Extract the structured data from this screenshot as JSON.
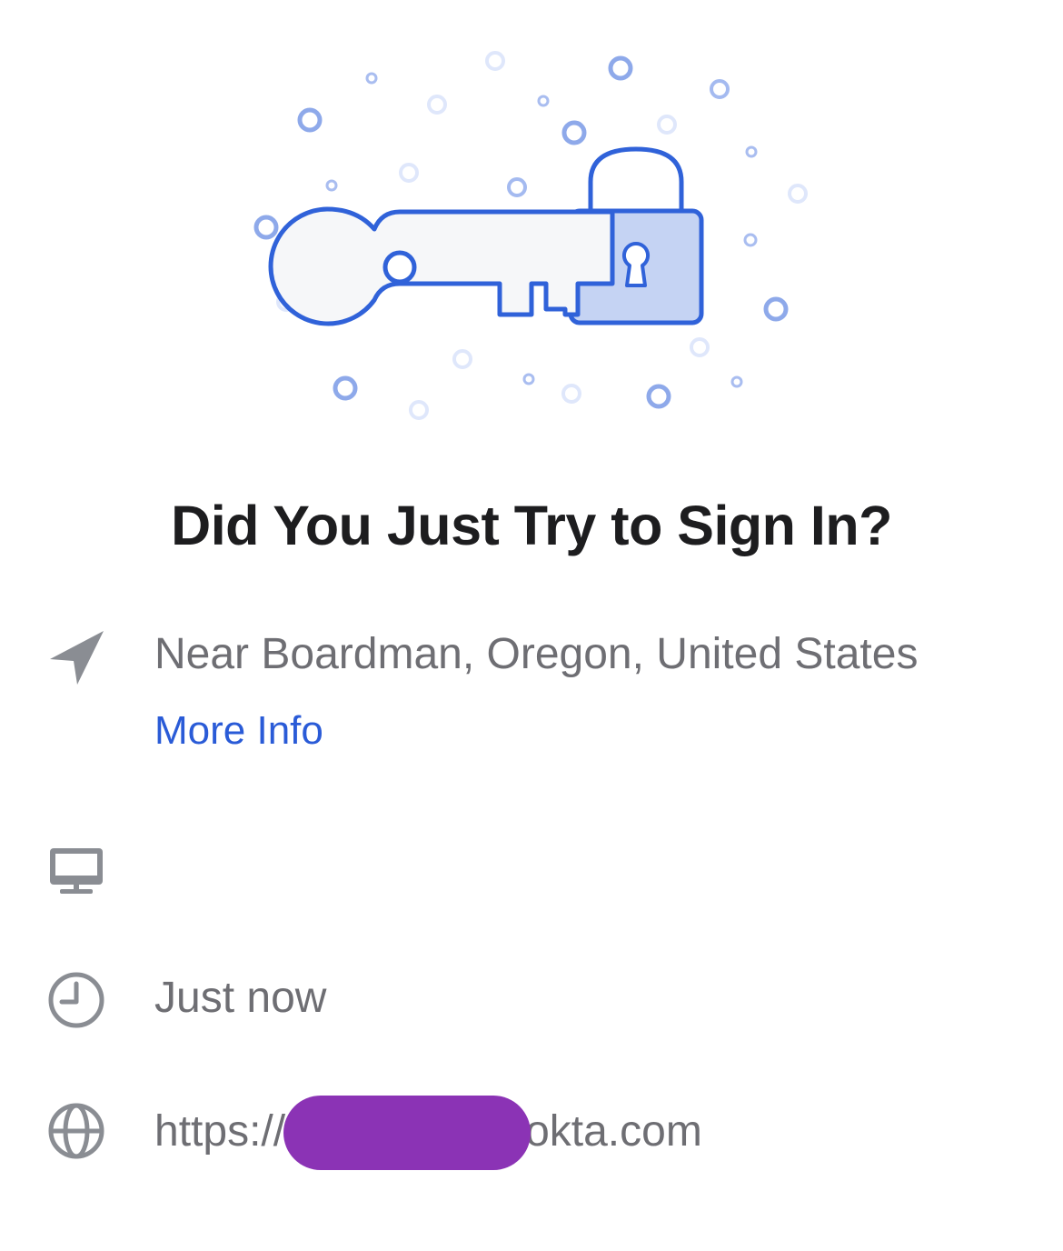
{
  "title": "Did You Just Try to Sign In?",
  "location": {
    "icon": "location-arrow-icon",
    "text": "Near Boardman, Oregon, United States",
    "more_info_label": "More Info"
  },
  "device": {
    "icon": "desktop-monitor-icon",
    "text": ""
  },
  "time": {
    "icon": "clock-icon",
    "text": "Just now"
  },
  "url": {
    "icon": "globe-icon",
    "prefix": "https://",
    "suffix": "okta.com"
  },
  "colors": {
    "accent": "#2a5bd7",
    "illustration_blue": "#3062d9",
    "lock_fill": "#c5d3f3",
    "muted_text": "#6e6e73",
    "title_text": "#1d1d1f",
    "redaction": "#8b33b5"
  }
}
